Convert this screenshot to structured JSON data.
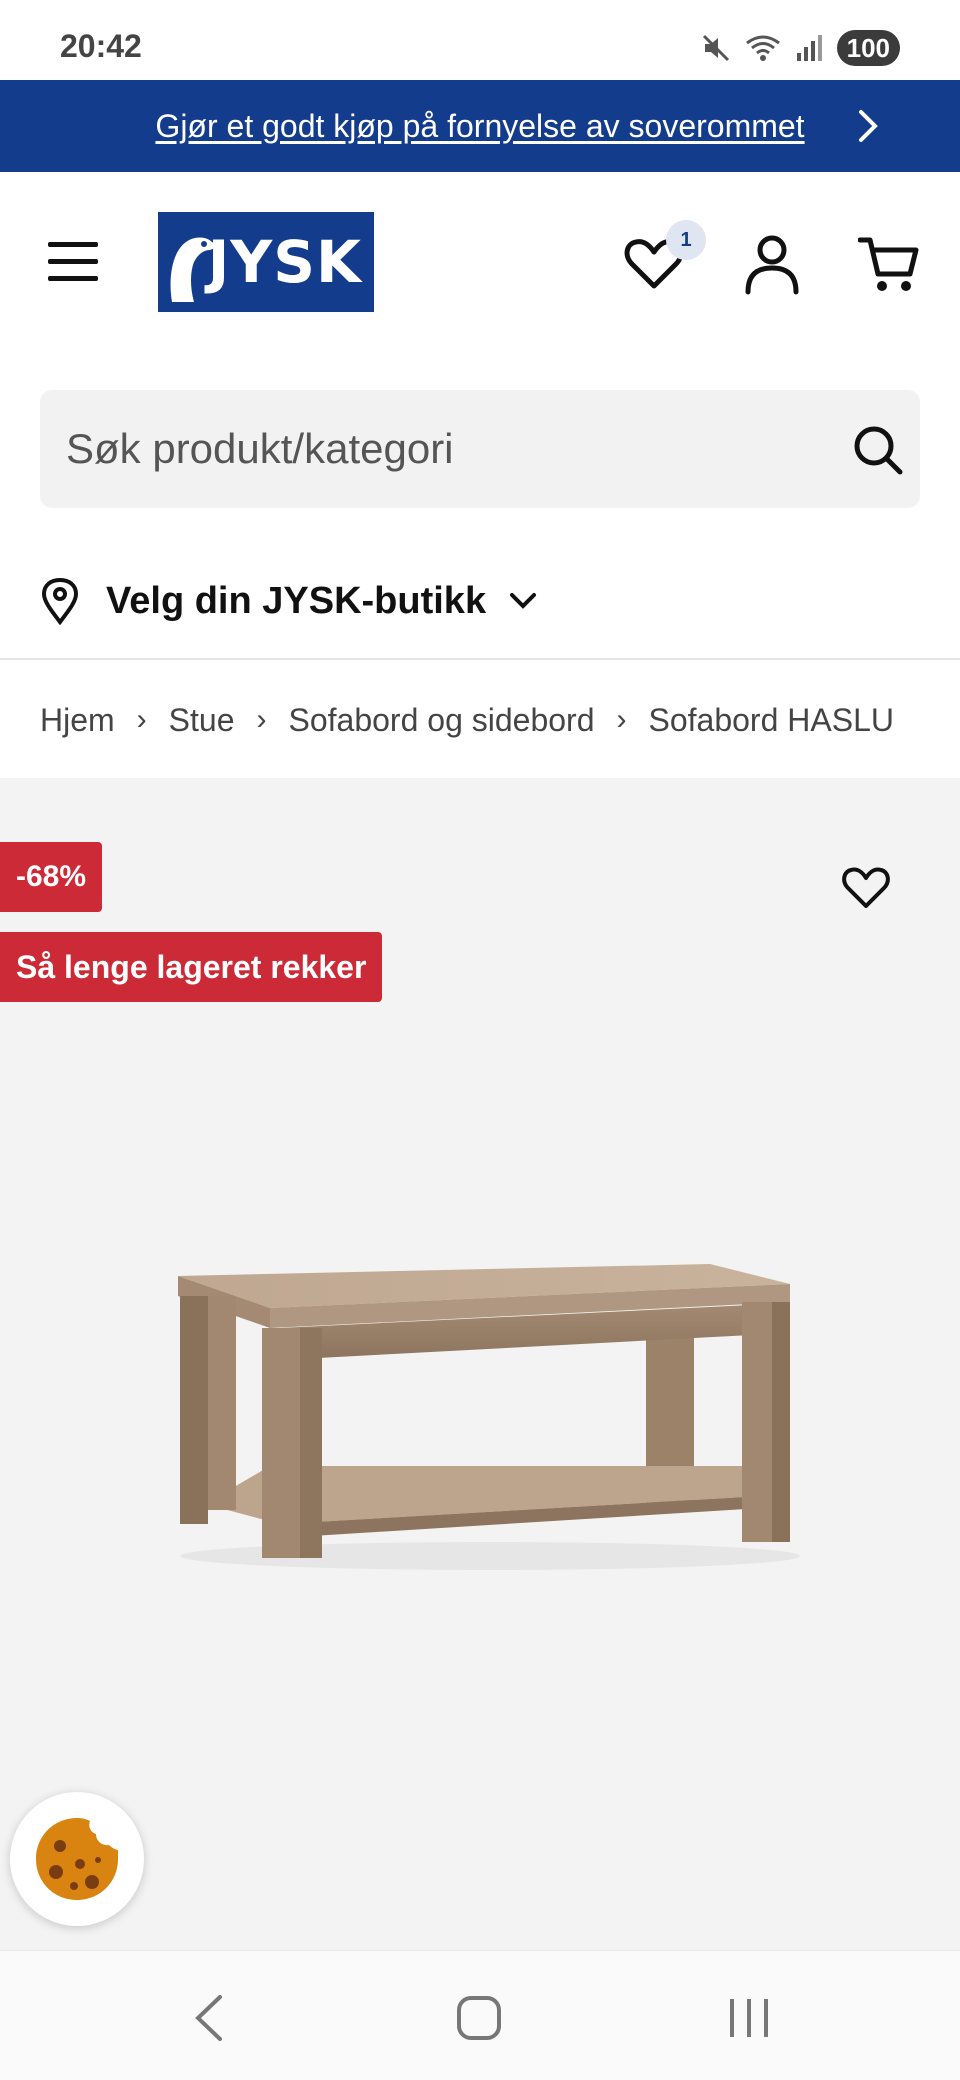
{
  "status_bar": {
    "time": "20:42",
    "battery": "100",
    "icons": [
      "mute-icon",
      "wifi-icon",
      "signal-icon",
      "battery-icon"
    ]
  },
  "promo_banner": {
    "text": "Gjør et godt kjøp på fornyelse av soverommet",
    "color": "#143c8c"
  },
  "header": {
    "logo_text": "JYSK",
    "wishlist_count": "1",
    "icons": [
      "menu-icon",
      "heart-icon",
      "user-icon",
      "cart-icon"
    ]
  },
  "search": {
    "placeholder": "Søk produkt/kategori"
  },
  "store_selector": {
    "label": "Velg din JYSK-butikk"
  },
  "breadcrumb": {
    "items": [
      "Hjem",
      "Stue",
      "Sofabord og sidebord",
      "Sofabord HASLU"
    ]
  },
  "product": {
    "discount_badge": "-68%",
    "stock_badge": "Så lenge lageret rekker",
    "badge_color": "#cc2a36"
  }
}
